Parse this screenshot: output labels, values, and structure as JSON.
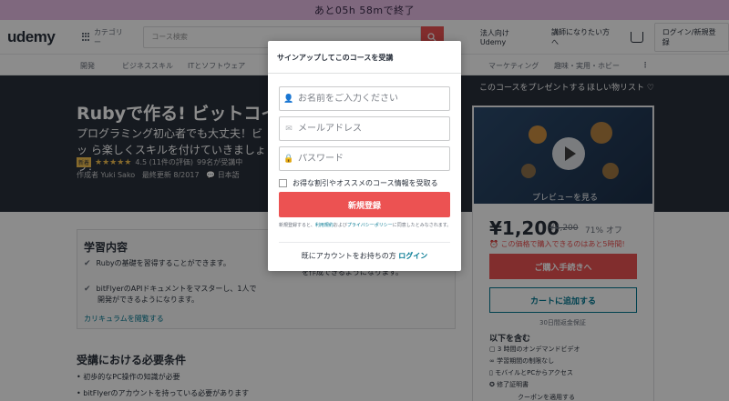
{
  "banner": {
    "text": "あと05h 58mで終了"
  },
  "header": {
    "logo": "udemy",
    "categories_label": "カテゴリー",
    "search_placeholder": "コース検索",
    "business_link": "法人向けUdemy",
    "teach_link": "講師になりたい方へ",
    "login_button": "ログイン/新規登録"
  },
  "catnav": {
    "items": [
      "開発",
      "ビジネススキル",
      "ITとソフトウェア",
      "マーケティング",
      "趣味・実用・ホビー"
    ]
  },
  "hero": {
    "title": "Rubyで作る! ビットコイ",
    "subtitle": "プログラミング初心者でも大丈夫！ビッ ら楽しくスキルを付けていきましょう！",
    "badge": "新着",
    "stars": "★★★★★",
    "rating": "4.5 (11件の評価)",
    "students": "99名が受講中",
    "instructor": "作成者 Yuki Sako",
    "updated": "最終更新 8/2017",
    "language": "日本語",
    "present_link": "このコースをプレゼントする",
    "wishlist_link": "ほしい物リスト"
  },
  "learn": {
    "title": "学習内容",
    "items": [
      "Rubyの基礎を習得することができます。",
      "bitFlyerのAPIドキュメントをマスターし、1人で開発ができるようになります。"
    ],
    "right_snippet": "を作成できるようになります。",
    "curriculum_link": "カリキュラムを閲覧する"
  },
  "requirements": {
    "title": "受講における必要条件",
    "items": [
      "初歩的なPC操作の知識が必要",
      "bitFlyerのアカウントを持っている必要があります"
    ]
  },
  "sidebar": {
    "preview_label": "プレビューを見る",
    "price": "¥1,200",
    "original_price": "¥4,200",
    "discount": "71% オフ",
    "timer": "この価格で購入できるのはあと5時間!",
    "buy_button": "ご購入手続きへ",
    "cart_button": "カートに追加する",
    "guarantee": "30日間返金保証",
    "includes_title": "以下を含む",
    "includes": [
      "3 時間のオンデマンドビデオ",
      "学習期間の制限なし",
      "モバイルとPCからアクセス",
      "修了証明書"
    ],
    "coupon": "クーポンを適用する"
  },
  "modal": {
    "title": "サインアップしてこのコースを受講",
    "close": "×",
    "name_placeholder": "お名前をご入力ください",
    "email_placeholder": "メールアドレス",
    "password_placeholder": "パスワード",
    "promo_label": "お得な割引やオススメのコース情報を受取る",
    "signup_button": "新規登録",
    "terms_prefix": "新規登録すると、",
    "terms_link": "利用規約",
    "terms_and": "および",
    "privacy_link": "プライバシーポリシー",
    "terms_suffix": "に同意したとみなされます。",
    "has_account": "既にアカウントをお持ちの方",
    "login_link": "ログイン"
  }
}
